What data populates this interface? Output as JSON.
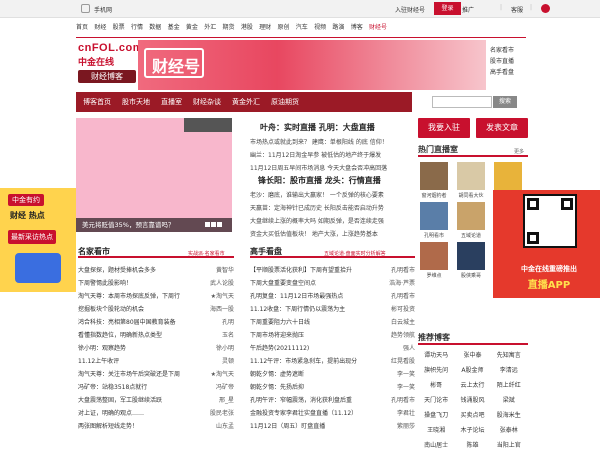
{
  "topbar": {
    "mobile": "手机网",
    "signup": "入驻财经号",
    "login": "登录",
    "cfol": "推广",
    "kefu": "客服",
    "sep": "|"
  },
  "nav": [
    "首页",
    "财经",
    "股票",
    "行情",
    "数据",
    "基金",
    "黄金",
    "外汇",
    "期货",
    "港股",
    "理财",
    "原创",
    "汽车",
    "视频",
    "路演",
    "博客",
    "财经号"
  ],
  "logo": {
    "l1": "cnFOL.com",
    "l2": "中金在线",
    "l3": "财经博客"
  },
  "banner": {
    "title": "财经号"
  },
  "side_links": [
    "名家看市",
    "股市直播",
    "高手看盘"
  ],
  "menu": [
    "博客首页",
    "股市天地",
    "直播室",
    "财经杂谈",
    "黄金外汇",
    "原油期货"
  ],
  "search": {
    "placeholder": "",
    "button": "搜索"
  },
  "slide": {
    "caption": "美元将贬值35%，预言靠谱吗？"
  },
  "headline1": "叶舟：实时直播 孔明：大盘直播",
  "para1": [
    "市场热点或就此到来？ 建鹰：单根阳线 的底 信仰！",
    "幽兰：11月12日淘金早参 被低估的地产终于爆发",
    "11月12日周五早间市场消息 今天大盘会否冲高回落"
  ],
  "headline2": "锋长阳：股市直播 龙头：行情直播",
  "para2": [
    "老沙：磨底，谁输出大赢家！ 一个反弹的核心要素",
    "天赢苗：定海神针已成历史 长阳反击能否启动升势",
    "大盘继续上涨的概率大吗 如期反弹，是否连续走强",
    "资金大买低估值板块！ 地产大涨，上涨趋势基本"
  ],
  "sec_mj": {
    "title": "名家看市",
    "more": "实战派·名家看市"
  },
  "list_mj": [
    {
      "t": "大盘探探，题材受捧机会多多",
      "a": "黄智华"
    },
    {
      "t": "下周警惕此股影响！",
      "a": "武人论股"
    },
    {
      "t": "淘气天尊：本周市场探底反弹，下周行",
      "a": "★淘气天"
    },
    {
      "t": "挖掘板块个股轮动的机会",
      "a": "海西一股"
    },
    {
      "t": "鸿合科技：亮相第80届中国教育装备",
      "a": "孔明"
    },
    {
      "t": "看懂指数趋位，明确新热点类型",
      "a": "玉名"
    },
    {
      "t": "徐小明：观察趋势",
      "a": "徐小明"
    },
    {
      "t": "11.12上午收评",
      "a": "灵顿"
    },
    {
      "t": "淘气天尊：关注市场午后突破还是下周",
      "a": "★淘气天"
    },
    {
      "t": "冯矿帝：站稳3518点就行",
      "a": "冯矿帝"
    },
    {
      "t": "大盘震荡整固，军工股继续活跃",
      "a": "邢_星"
    },
    {
      "t": "对上证，明确的观点……",
      "a": "股民老张"
    },
    {
      "t": "两张图解析短线走势！",
      "a": "山东孟"
    }
  ],
  "sec_gs": {
    "title": "高手看盘",
    "more": "五域论道·盘面实时分析解答"
  },
  "list_gs": [
    {
      "t": "【平顺股票活化获利】下周有望重拾升",
      "a": "孔明看市"
    },
    {
      "t": "下周大盘重要变盘空间点",
      "a": "浩海·芦票"
    },
    {
      "t": "孔明复盘：11月12日市场最强热点",
      "a": "孔明看市"
    },
    {
      "t": "11.12收盘：下周行情仍以震荡为主",
      "a": "彬可投资"
    },
    {
      "t": "下周重要阻力六十日线",
      "a": "白云城主"
    },
    {
      "t": "下周市场将迎来抛压",
      "a": "趋势领航"
    },
    {
      "t": "午后趋势(20211112)",
      "a": "强人"
    },
    {
      "t": "11.12午评：市场紧急刹车，提前出现分",
      "a": "红晃看股"
    },
    {
      "t": "朝乾夕惕：虚势遮断",
      "a": "李一笑"
    },
    {
      "t": "朝乾夕惕：先扬后抑",
      "a": "李一笑"
    },
    {
      "t": "孔明午评：窄幅震荡，消化获利盘后重",
      "a": "孔明看市"
    },
    {
      "t": "金融投资专家李君壮实盘直播（11.12）",
      "a": "李君壮"
    },
    {
      "t": "11月12日（周五）盯盘直播",
      "a": "紫丽莎"
    }
  ],
  "btn_join": "我要入驻",
  "btn_post": "发表文章",
  "hot_live": {
    "title": "热门直播室",
    "more": "更多"
  },
  "avatars": [
    "窗河烟钓者",
    "胡同看大伙",
    "龙头1990",
    "孔明看市",
    "五域论道",
    "老孙头",
    "罗维点",
    "股侠乘哥",
    "子不问股海"
  ],
  "qr_ad": {
    "t1": "中金在线重磅推出",
    "t2": "直播APP"
  },
  "left_ad": {
    "a1": "中金有约",
    "a2": "财经 热点",
    "a3": "最新采访热点"
  },
  "rec_blog": {
    "title": "推荐博客"
  },
  "blogs": [
    "谭功天马",
    "张中泰",
    "先知寓言",
    "旗帜先问",
    "A股金师",
    "李清远",
    "彬哥",
    "云上太行",
    "陌上纤红",
    "天门论市",
    "钱涌股风",
    "梁斌",
    "操盘飞刀",
    "买卖点吧",
    "股海米生",
    "王晓湘",
    "木子论坛",
    "张泰林",
    "南山居士",
    "陈雄",
    "当阳上官"
  ]
}
